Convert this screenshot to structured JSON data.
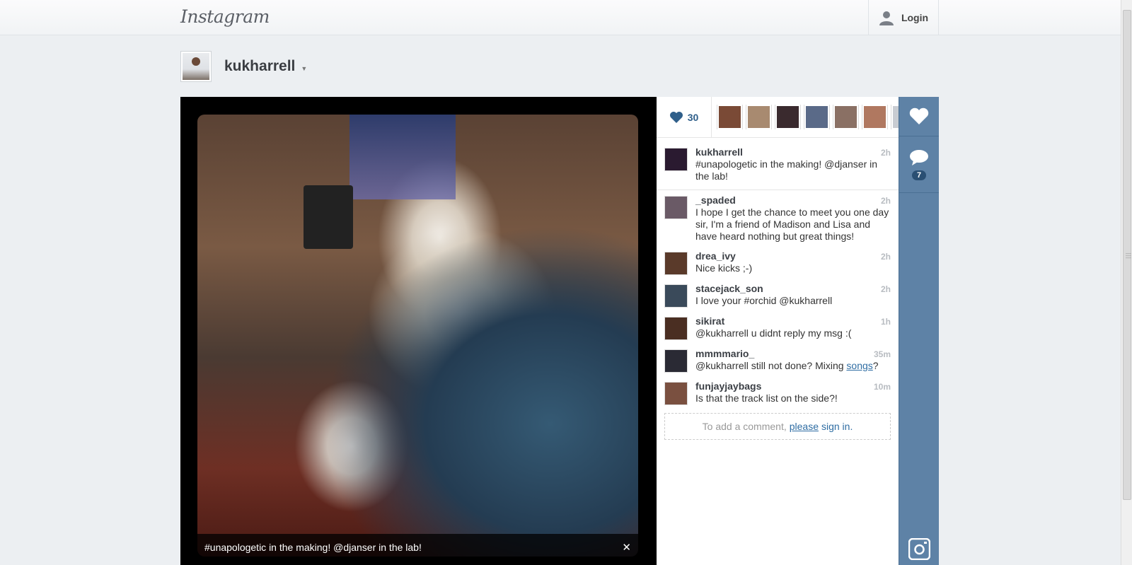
{
  "header": {
    "logo": "Instagram",
    "login_label": "Login"
  },
  "profile": {
    "username": "kukharrell"
  },
  "photo": {
    "caption": "#unapologetic in the making! @djanser in the lab!"
  },
  "likes": {
    "count": "30",
    "likers": [
      "#7a4a36",
      "#a88a70",
      "#3a2a2e",
      "#5a6a88",
      "#8a7064",
      "#b07860",
      "#c8ccd2"
    ]
  },
  "caption_comment": {
    "user": "kukharrell",
    "time": "2h",
    "text": "#unapologetic in the making! @djanser in the lab!",
    "avatar_color": "#2a1a30"
  },
  "comments": [
    {
      "user": "_spaded",
      "time": "2h",
      "text": "I hope I get the chance to meet you one day sir, I'm a friend of Madison and Lisa and have heard nothing but great things!",
      "avatar_color": "#6a5a66"
    },
    {
      "user": "drea_ivy",
      "time": "2h",
      "text": "Nice kicks ;-)",
      "avatar_color": "#5a3a2a"
    },
    {
      "user": "stacejack_son",
      "time": "2h",
      "text": "I love your #orchid @kukharrell",
      "avatar_color": "#3a4a5a"
    },
    {
      "user": "sikirat",
      "time": "1h",
      "text": "@kukharrell u didnt reply my msg :(",
      "avatar_color": "#4a2e22"
    },
    {
      "user": "mmmmario_",
      "time": "35m",
      "text_before": "@kukharrell still not done? Mixing ",
      "link": "songs",
      "text_after": "?",
      "avatar_color": "#2a2a34"
    },
    {
      "user": "funjayjaybags",
      "time": "10m",
      "text": "Is that the track list on the side?!",
      "avatar_color": "#7a5040"
    }
  ],
  "add_comment": {
    "before": "To add a comment,",
    "link": "please",
    "signin": "sign in."
  },
  "actions": {
    "comment_count": "7"
  },
  "colors": {
    "accent": "#5e82a6",
    "link": "#2f6da3",
    "likes_text": "#2f5f8a"
  }
}
